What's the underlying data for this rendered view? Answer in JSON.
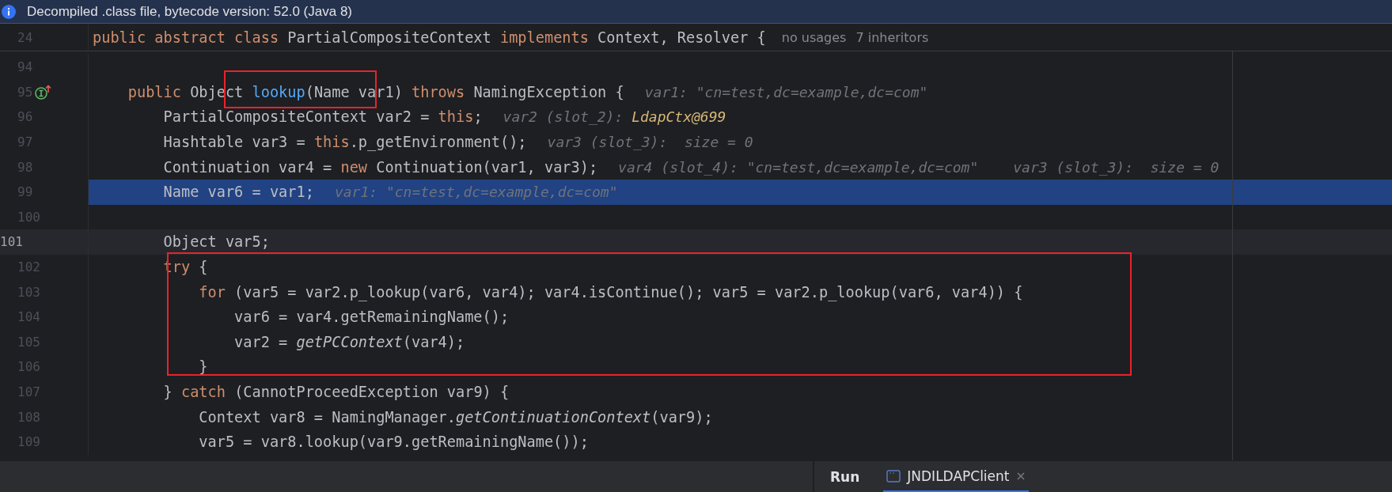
{
  "banner": {
    "text": "Decompiled .class file, bytecode version: 52.0 (Java 8)"
  },
  "sticky_header": {
    "number": "24",
    "segments": [
      {
        "t": "public abstract class",
        "kind": "kw"
      },
      {
        "t": " PartialCompositeContext ",
        "kind": "plain"
      },
      {
        "t": "implements",
        "kind": "kw"
      },
      {
        "t": " Context, Resolver {",
        "kind": "plain"
      }
    ],
    "meta": [
      "no usages",
      "7 inheritors"
    ]
  },
  "lines": [
    {
      "number": "94",
      "selected": false,
      "current": false
    },
    {
      "number": "95",
      "selected": false,
      "current": false,
      "marker": true,
      "segments": [
        {
          "t": "    public",
          "kind": "kw"
        },
        {
          "t": " Object ",
          "kind": "plain"
        },
        {
          "t": "lookup",
          "kind": "decl"
        },
        {
          "t": "(Name var1) ",
          "kind": "plain"
        },
        {
          "t": "throws",
          "kind": "kw"
        },
        {
          "t": " NamingException {",
          "kind": "plain"
        }
      ],
      "hints": [
        {
          "text": "var1: \"cn=test,dc=example,dc=com\""
        }
      ]
    },
    {
      "number": "96",
      "selected": false,
      "current": false,
      "segments": [
        {
          "t": "        PartialCompositeContext var2 = ",
          "kind": "plain"
        },
        {
          "t": "this",
          "kind": "kw"
        },
        {
          "t": ";",
          "kind": "plain"
        }
      ],
      "hints": [
        {
          "text": "var2 (slot_2): ",
          "value": "LdapCtx@699"
        }
      ]
    },
    {
      "number": "97",
      "selected": false,
      "current": false,
      "segments": [
        {
          "t": "        Hashtable var3 = ",
          "kind": "plain"
        },
        {
          "t": "this",
          "kind": "kw"
        },
        {
          "t": ".p_getEnvironment();",
          "kind": "plain"
        }
      ],
      "hints": [
        {
          "text": "var3 (slot_3):  size = 0"
        }
      ]
    },
    {
      "number": "98",
      "selected": false,
      "current": false,
      "segments": [
        {
          "t": "        Continuation var4 = ",
          "kind": "plain"
        },
        {
          "t": "new",
          "kind": "kw"
        },
        {
          "t": " Continuation(var1, var3);",
          "kind": "plain"
        }
      ],
      "hints": [
        {
          "text": "var4 (slot_4): \"cn=test,dc=example,dc=com\""
        },
        {
          "text": "var3 (slot_3):  size = 0"
        }
      ]
    },
    {
      "number": "99",
      "selected": true,
      "current": false,
      "segments": [
        {
          "t": "        Name var6 = var1;",
          "kind": "plain"
        }
      ],
      "hints": [
        {
          "text": "var1: \"cn=test,dc=example,dc=com\""
        }
      ]
    },
    {
      "number": "100",
      "selected": false,
      "current": false
    },
    {
      "number": "101",
      "selected": false,
      "current": true,
      "segments": [
        {
          "t": "        Object var5;",
          "kind": "plain"
        }
      ]
    },
    {
      "number": "102",
      "selected": false,
      "current": false,
      "segments": [
        {
          "t": "        try",
          "kind": "kw"
        },
        {
          "t": " {",
          "kind": "plain"
        }
      ]
    },
    {
      "number": "103",
      "selected": false,
      "current": false,
      "segments": [
        {
          "t": "            for",
          "kind": "kw"
        },
        {
          "t": " (var5 = var2.p_lookup(var6, var4); var4.isContinue(); var5 = var2.p_lookup(var6, var4)) {",
          "kind": "plain"
        }
      ]
    },
    {
      "number": "104",
      "selected": false,
      "current": false,
      "segments": [
        {
          "t": "                var6 = var4.getRemainingName();",
          "kind": "plain"
        }
      ]
    },
    {
      "number": "105",
      "selected": false,
      "current": false,
      "segments": [
        {
          "t": "                var2 = ",
          "kind": "plain"
        },
        {
          "t": "getPCContext",
          "kind": "static"
        },
        {
          "t": "(var4);",
          "kind": "plain"
        }
      ]
    },
    {
      "number": "106",
      "selected": false,
      "current": false,
      "segments": [
        {
          "t": "            }",
          "kind": "plain"
        }
      ]
    },
    {
      "number": "107",
      "selected": false,
      "current": false,
      "segments": [
        {
          "t": "        } ",
          "kind": "plain"
        },
        {
          "t": "catch",
          "kind": "kw"
        },
        {
          "t": " (CannotProceedException var9) {",
          "kind": "plain"
        }
      ]
    },
    {
      "number": "108",
      "selected": false,
      "current": false,
      "segments": [
        {
          "t": "            Context var8 = NamingManager.",
          "kind": "plain"
        },
        {
          "t": "getContinuationContext",
          "kind": "static"
        },
        {
          "t": "(var9);",
          "kind": "plain"
        }
      ]
    },
    {
      "number": "109",
      "selected": false,
      "current": false,
      "segments": [
        {
          "t": "            var5 = var8.lookup(var9.getRemainingName());",
          "kind": "plain"
        }
      ]
    }
  ],
  "annotations": [
    {
      "kind": "rectangle"
    },
    {
      "kind": "rectangle"
    }
  ],
  "bottom_panel": {
    "title": "Run",
    "tabs": [
      {
        "label": "JNDILDAPClient",
        "selected": true
      }
    ]
  }
}
